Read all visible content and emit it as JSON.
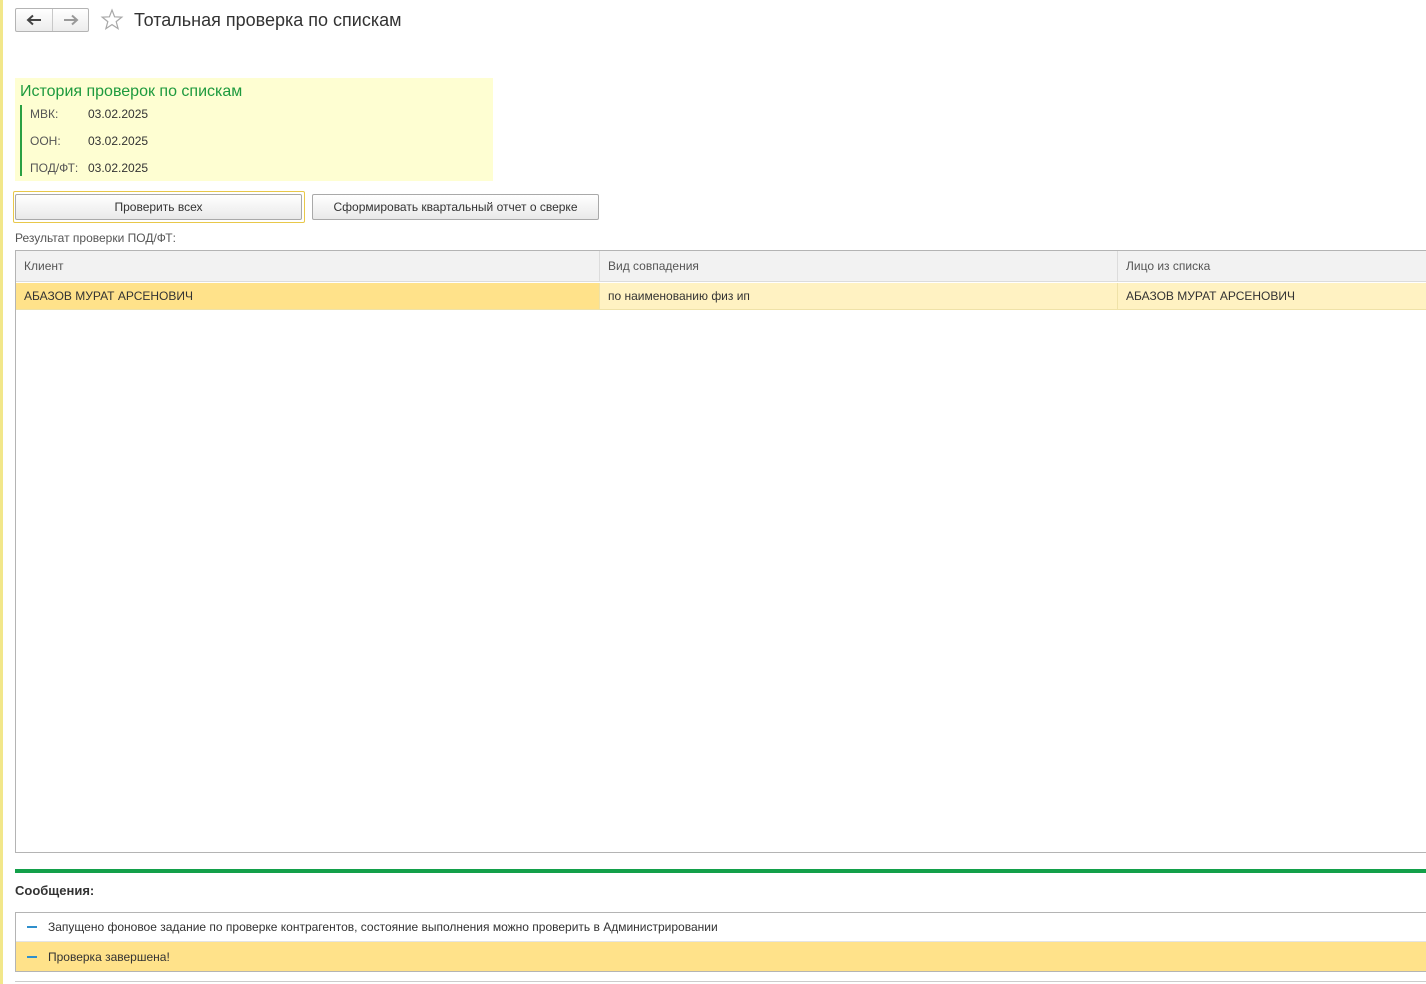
{
  "window": {
    "title": "Тотальная проверка по спискам"
  },
  "toolbar": {
    "back_icon": "arrow-left-icon",
    "forward_icon": "arrow-right-icon",
    "favorite_icon": "star-icon"
  },
  "history": {
    "title": "История проверок по спискам",
    "items": [
      {
        "label": "МВК:",
        "value": "03.02.2025"
      },
      {
        "label": "ООН:",
        "value": "03.02.2025"
      },
      {
        "label": "ПОД/ФТ:",
        "value": "03.02.2025"
      }
    ]
  },
  "actions": {
    "check_all_label": "Проверить всех",
    "quarter_report_label": "Сформировать квартальный отчет о сверке"
  },
  "result": {
    "label": "Результат проверки ПОД/ФТ:",
    "columns": [
      "Клиент",
      "Вид совпадения",
      "Лицо из списка"
    ],
    "rows": [
      [
        "АБАЗОВ МУРАТ АРСЕНОВИЧ",
        "по наименованию физ ип",
        "АБАЗОВ МУРАТ АРСЕНОВИЧ"
      ]
    ]
  },
  "messages": {
    "title": "Сообщения:",
    "items": [
      "Запущено фоновое задание по проверке контрагентов, состояние выполнения можно проверить в Администрировании",
      "Проверка завершена!"
    ]
  },
  "colors": {
    "accent_green": "#13a04a",
    "history_bg": "#fefed2",
    "row_selected": "#ffe28a",
    "row_current": "#fff2c2"
  }
}
